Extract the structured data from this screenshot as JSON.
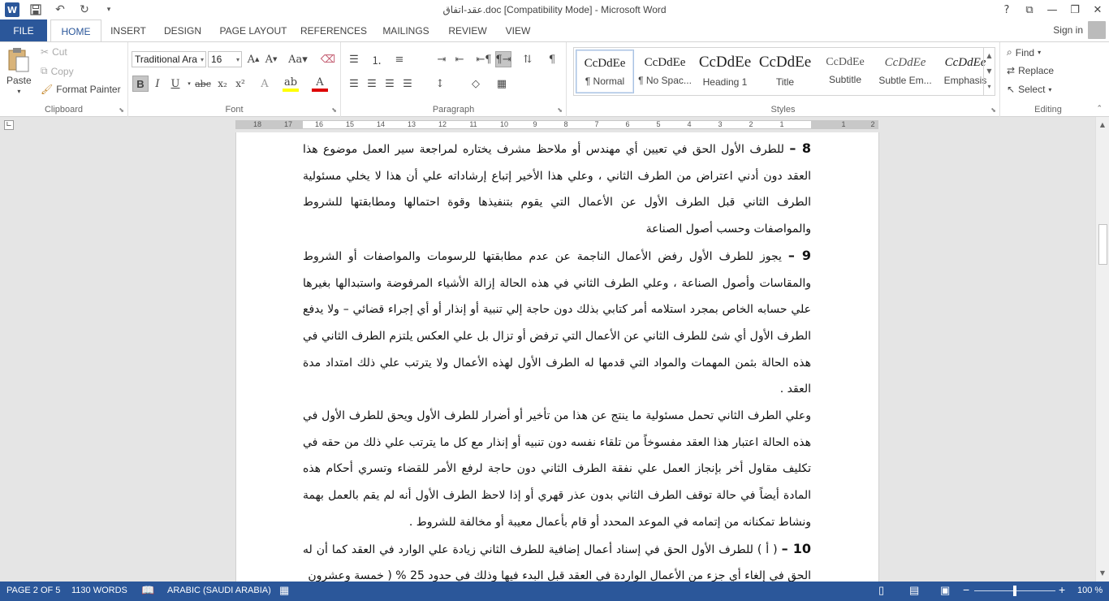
{
  "window": {
    "title": "عقد-اتفاق.doc [Compatibility Mode] - Microsoft Word",
    "help": "?",
    "app_icon": "W"
  },
  "tabs": {
    "file": "FILE",
    "home": "HOME",
    "insert": "INSERT",
    "design": "DESIGN",
    "page_layout": "PAGE LAYOUT",
    "references": "REFERENCES",
    "mailings": "MAILINGS",
    "review": "REVIEW",
    "view": "VIEW",
    "sign_in": "Sign in"
  },
  "clipboard": {
    "label": "Clipboard",
    "paste": "Paste",
    "cut": "Cut",
    "copy": "Copy",
    "format_painter": "Format Painter"
  },
  "font": {
    "label": "Font",
    "family": "Traditional Ara",
    "size": "16"
  },
  "paragraph": {
    "label": "Paragraph"
  },
  "styles": {
    "label": "Styles",
    "items": [
      {
        "preview": "CcDdEe",
        "name": "¶ Normal"
      },
      {
        "preview": "CcDdEe",
        "name": "¶ No Spac..."
      },
      {
        "preview": "CcDdEe",
        "name": "Heading 1"
      },
      {
        "preview": "CcDdEe",
        "name": "Title"
      },
      {
        "preview": "CcDdEe",
        "name": "Subtitle"
      },
      {
        "preview": "CcDdEe",
        "name": "Subtle Em..."
      },
      {
        "preview": "CcDdEe",
        "name": "Emphasis"
      }
    ]
  },
  "editing": {
    "label": "Editing",
    "find": "Find",
    "replace": "Replace",
    "select": "Select"
  },
  "ruler": {
    "numbers": [
      "18",
      "17",
      "16",
      "15",
      "14",
      "13",
      "12",
      "11",
      "10",
      "9",
      "8",
      "7",
      "6",
      "5",
      "4",
      "3",
      "2",
      "1",
      "1",
      "2"
    ]
  },
  "document": {
    "p8_num": "8 –",
    "p8": "للطرف الأول الحق في تعيين أي مهندس أو ملاحظ مشرف يختاره لمراجعة سير العمل موضوع هذا العقد دون أدني اعتراض من الطرف الثاني ، وعلي هذا الأخير إتباع إرشاداته علي أن هذا  لا يخلي مسئولية الطرف الثاني قبل الطرف الأول عن الأعمال التي يقوم بتنفيذها وقوة احتمالها ومطابقتها للشروط والمواصفات وحسب أصول الصناعة",
    "p9_num": "9 –",
    "p9": "يجوز للطرف الأول رفض الأعمال الناجمة عن عدم مطابقتها للرسومات والمواصفات أو الشروط والمقاسات وأصول الصناعة ، وعلي الطرف الثاني في هذه الحالة إزالة الأشياء المرفوضة واستبدالها بغيرها علي حسابه الخاص بمجرد استلامه أمر كتابي بذلك دون حاجة إلي تنبية أو إنذار أو أي إجراء قضائي – ولا يدفع الطرف الأول أي شئ للطرف الثاني عن الأعمال التي ترفض أو تزال بل علي العكس يلتزم الطرف الثاني في هذه الحالة بثمن المهمات والمواد التي قدمها له الطرف الأول لهذه الأعمال ولا يترتب علي ذلك امتداد مدة العقد .",
    "p_liability": "وعلي الطرف الثاني تحمل مسئولية ما ينتج عن هذا من تأخير أو أضرار للطرف الأول ويحق للطرف الأول في هذه الحالة اعتبار هذا العقد مفسوخاً من تلقاء نفسه دون تنبيه أو إنذار مع كل ما يترتب علي ذلك من حقه في تكليف مقاول أخر بإنجاز العمل علي نفقة الطرف الثاني دون حاجة لرفع الأمر للقضاء وتسري أحكام هذه المادة أيضاً في حالة توقف الطرف الثاني بدون عذر قهري أو إذا لاحظ الطرف الأول أنه لم يقم بالعمل بهمة ونشاط تمكنانه من إتمامه في الموعد المحدد أو قام بأعمال معيبة أو مخالفة للشروط .",
    "p10_num": "10 –",
    "p10": "( أ ) للطرف الأول الحق في إسناد أعمال إضافية للطرف الثاني زيادة علي الوارد في العقد كما أن له الحق في إلغاء أي جزء من الأعمال الواردة في العقد قبل البدء فيها وذلك في حدود 25 % ( خمسة وعشرون"
  },
  "status": {
    "page": "PAGE 2 OF 5",
    "words": "1130 WORDS",
    "language": "ARABIC (SAUDI ARABIA)",
    "zoom": "100 %",
    "zoom_value": 100
  },
  "colors": {
    "accent": "#2b579a"
  }
}
